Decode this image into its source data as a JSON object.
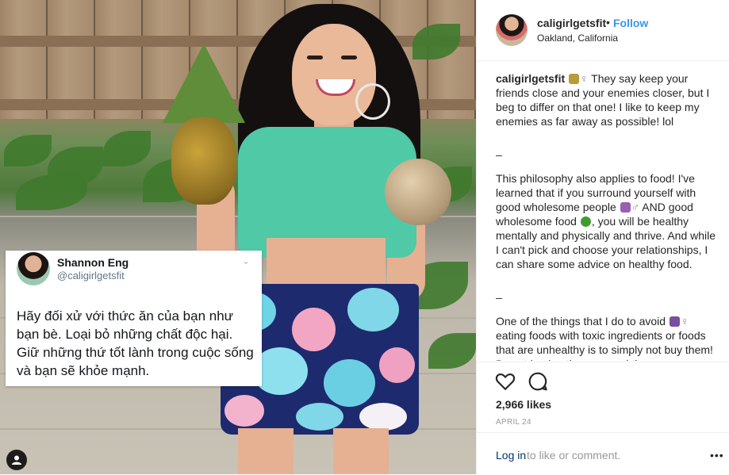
{
  "tweet": {
    "name": "Shannon Eng",
    "handle": "@caligirlgetsfit",
    "text": "Hãy đối xử với thức ăn của bạn như bạn bè. Loại bỏ những chất độc hại. Giữ những thứ tốt lành trong cuộc sống và bạn sẽ khỏe mạnh."
  },
  "post_header": {
    "username": "caligirlgetsfit",
    "separator": "•",
    "follow_label": "Follow",
    "location": "Oakland, California",
    "accent_color": "#3897f0"
  },
  "caption": {
    "username": "caligirlgetsfit",
    "para1": "They say keep your friends close and your enemies closer, but I beg to differ on that one! I like to keep my enemies as far away as possible! lol",
    "sep1": "_",
    "para2a": "This philosophy also applies to food! I've learned that if you surround yourself with good wholesome people",
    "para2b": "AND good wholesome food",
    "para2c": ", you will be healthy mentally and physically and thrive. And while I can't pick and choose your relationships, I can share some advice on healthy food.",
    "sep2": "_",
    "para3a": "One of the things that I do to avoid",
    "para3b": "eating foods with toxic ingredients or foods that are unhealthy is to simply not buy them! By not having them around the"
  },
  "actions": {
    "like_icon": "heart-outline-icon",
    "comment_icon": "speech-bubble-icon",
    "likes": "2,966 likes",
    "date": "APRIL 24"
  },
  "comment_bar": {
    "login_link": "Log in",
    "login_rest": "to like or comment.",
    "more_label": "•••"
  }
}
